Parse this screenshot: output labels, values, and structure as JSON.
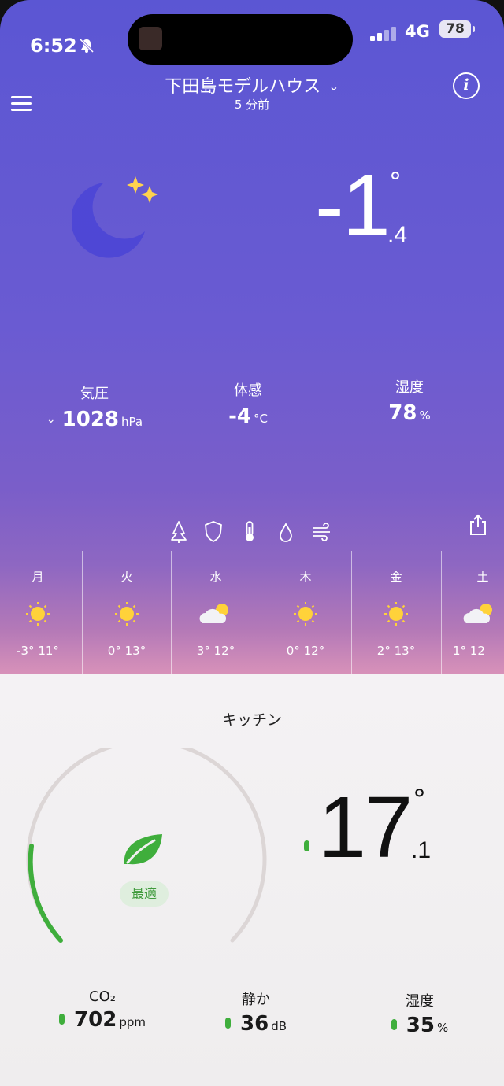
{
  "status_bar": {
    "time": "6:52",
    "network": "4G",
    "battery": "78"
  },
  "header": {
    "title": "下田島モデルハウス",
    "subtitle": "5 分前"
  },
  "outdoor": {
    "temp_int": "-1",
    "temp_dec": ".4",
    "degree": "°",
    "stats": [
      {
        "label": "気圧",
        "value": "1028",
        "unit": "hPa"
      },
      {
        "label": "体感",
        "value": "-4",
        "unit": "°C"
      },
      {
        "label": "湿度",
        "value": "78",
        "unit": "%"
      }
    ]
  },
  "tab_icons": [
    "pollen-icon",
    "shield-icon",
    "thermometer-icon",
    "drop-icon",
    "wind-icon"
  ],
  "forecast": [
    {
      "day": "月",
      "icon": "sun-icon",
      "temps": "-3°  11°"
    },
    {
      "day": "火",
      "icon": "sun-icon",
      "temps": "0°  13°"
    },
    {
      "day": "水",
      "icon": "cloud-sun-icon",
      "temps": "3°  12°"
    },
    {
      "day": "木",
      "icon": "sun-icon",
      "temps": "0°  12°"
    },
    {
      "day": "金",
      "icon": "sun-icon",
      "temps": "2°  13°"
    },
    {
      "day": "土",
      "icon": "cloud-sun-icon",
      "temps": "1°  12"
    }
  ],
  "room": {
    "name": "キッチン",
    "status": "最適",
    "temp_int": "17",
    "temp_dec": ".1",
    "degree": "°",
    "gauge_level": 0.12,
    "stats": [
      {
        "label": "CO₂",
        "value": "702",
        "unit": "ppm"
      },
      {
        "label": "静か",
        "value": "36",
        "unit": "dB"
      },
      {
        "label": "湿度",
        "value": "35",
        "unit": "%"
      }
    ]
  },
  "colors": {
    "accent_green": "#3fae3c",
    "sky_top": "#5b56d3",
    "sky_bottom": "#e6a5c1"
  }
}
